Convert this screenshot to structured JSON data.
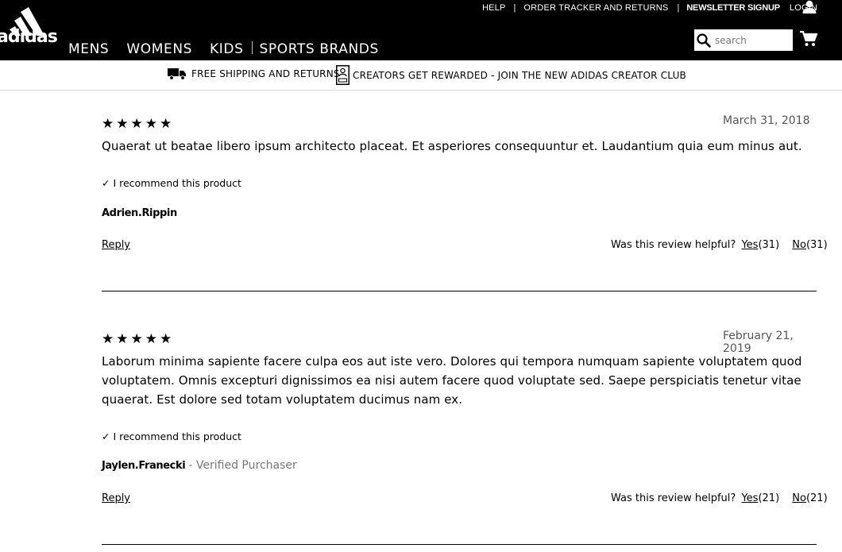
{
  "header": {
    "utility_links": [
      "HELP",
      "ORDER TRACKER AND RETURNS",
      "NEWSLETTER SIGNUP",
      "LOGIN"
    ],
    "separator": "|",
    "logo_text": "adidas",
    "nav": [
      "MENS",
      "WOMENS",
      "KIDS",
      "SPORTS BRANDS"
    ],
    "search_placeholder": "search",
    "icons": [
      "adidas-logo",
      "user-icon",
      "search-icon",
      "cart-icon"
    ]
  },
  "promo": {
    "shipping": "FREE SHIPPING AND RETURNS",
    "creators": "CREATORS GET REWARDED - JOIN THE NEW ADIDAS CREATOR CLUB",
    "icons": [
      "truck-icon",
      "creator-badge-icon"
    ]
  },
  "reviews": [
    {
      "stars": "★★★★★",
      "rating": 5,
      "date": "March 31, 2018",
      "body": "Quaerat ut beatae libero ipsum architecto placeat. Et asperiores consequuntur et. Laudantium quia eum minus aut.",
      "recommend": "✓ I recommend this product",
      "author": "Adrien.Rippin",
      "verified": "",
      "reply": "Reply",
      "helpful_prompt": "Was this review helpful?",
      "yes_label": "Yes",
      "yes_count": "(31)",
      "no_label": "No",
      "no_count": "(31)"
    },
    {
      "stars": "★★★★★",
      "rating": 5,
      "date": "February 21, 2019",
      "body": "Laborum minima sapiente facere culpa eos aut iste vero. Dolores qui tempora numquam sapiente voluptatem quod voluptatem. Omnis excepturi dignissimos ea nisi autem facere quod voluptate sed. Saepe perspiciatis tenetur vitae quaerat. Est dolore sed totam voluptatem ducimus nam ex.",
      "recommend": "✓ I recommend this product",
      "author": "Jaylen.Franecki",
      "verified": "- Verified Purchaser",
      "reply": "Reply",
      "helpful_prompt": "Was this review helpful?",
      "yes_label": "Yes",
      "yes_count": "(21)",
      "no_label": "No",
      "no_count": "(21)"
    }
  ]
}
